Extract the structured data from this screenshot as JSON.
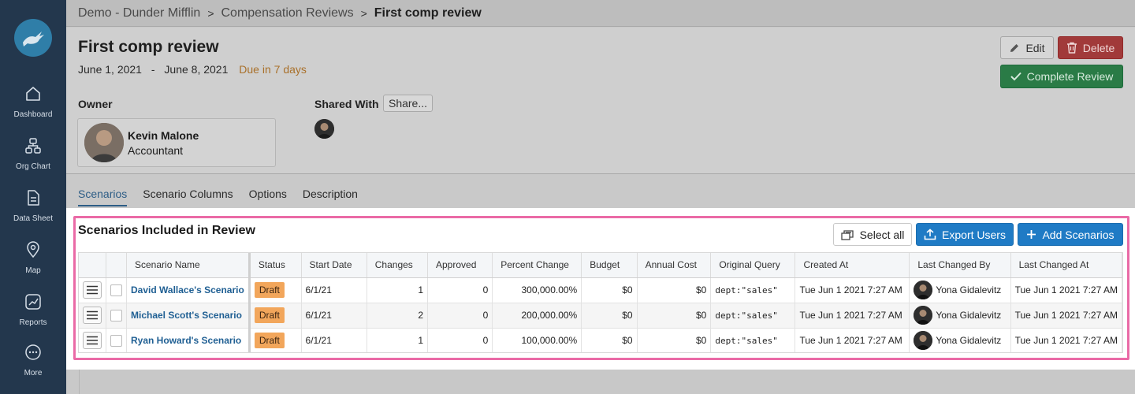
{
  "sidebar": {
    "logo_icon": "rabbit-logo-icon",
    "items": [
      {
        "label": "Dashboard",
        "icon": "home-icon"
      },
      {
        "label": "Org Chart",
        "icon": "org-chart-icon"
      },
      {
        "label": "Data Sheet",
        "icon": "document-icon"
      },
      {
        "label": "Map",
        "icon": "map-pin-icon"
      },
      {
        "label": "Reports",
        "icon": "chart-icon"
      },
      {
        "label": "More",
        "icon": "more-icon"
      }
    ]
  },
  "breadcrumb": {
    "items": [
      "Demo - Dunder Mifflin",
      "Compensation Reviews",
      "First comp review"
    ],
    "separator": ">"
  },
  "review": {
    "title": "First comp review",
    "start_date": "June 1, 2021",
    "date_separator": "-",
    "end_date": "June 8, 2021",
    "due": "Due in 7 days",
    "owner_label": "Owner",
    "owner_name": "Kevin Malone",
    "owner_role": "Accountant",
    "shared_label": "Shared With",
    "share_button": "Share..."
  },
  "actions": {
    "edit": "Edit",
    "delete": "Delete",
    "complete": "Complete Review"
  },
  "tabs": [
    {
      "label": "Scenarios",
      "active": true
    },
    {
      "label": "Scenario Columns",
      "active": false
    },
    {
      "label": "Options",
      "active": false
    },
    {
      "label": "Description",
      "active": false
    }
  ],
  "panel": {
    "title": "Scenarios Included in Review",
    "select_all": "Select all",
    "export_users": "Export Users",
    "add_scenarios": "Add Scenarios"
  },
  "table": {
    "columns": [
      "Scenario Name",
      "Status",
      "Start Date",
      "Changes",
      "Approved",
      "Percent Change",
      "Budget",
      "Annual Cost",
      "Original Query",
      "Created At",
      "Last Changed By",
      "Last Changed At"
    ],
    "rows": [
      {
        "name": "David Wallace's Scenario",
        "status": "Draft",
        "start_date": "6/1/21",
        "changes": "1",
        "approved": "0",
        "percent_change": "300,000.00%",
        "budget": "$0",
        "annual_cost": "$0",
        "query": "dept:\"sales\"",
        "created_at": "Tue Jun 1 2021 7:27 AM",
        "last_changed_by": "Yona Gidalevitz",
        "last_changed_at": "Tue Jun 1 2021 7:27 AM"
      },
      {
        "name": "Michael Scott's Scenario",
        "status": "Draft",
        "start_date": "6/1/21",
        "changes": "2",
        "approved": "0",
        "percent_change": "200,000.00%",
        "budget": "$0",
        "annual_cost": "$0",
        "query": "dept:\"sales\"",
        "created_at": "Tue Jun 1 2021 7:27 AM",
        "last_changed_by": "Yona Gidalevitz",
        "last_changed_at": "Tue Jun 1 2021 7:27 AM"
      },
      {
        "name": "Ryan Howard's Scenario",
        "status": "Draft",
        "start_date": "6/1/21",
        "changes": "1",
        "approved": "0",
        "percent_change": "100,000.00%",
        "budget": "$0",
        "annual_cost": "$0",
        "query": "dept:\"sales\"",
        "created_at": "Tue Jun 1 2021 7:27 AM",
        "last_changed_by": "Yona Gidalevitz",
        "last_changed_at": "Tue Jun 1 2021 7:27 AM"
      }
    ]
  },
  "colors": {
    "sidebar": "#23374d",
    "accent_blue": "#1f7bc5",
    "delete_red": "#c0392b",
    "complete_green": "#2e8b57",
    "draft_badge": "#f2a65b",
    "highlight_outline": "#ea6aa6",
    "due_text": "#c27c1c"
  }
}
